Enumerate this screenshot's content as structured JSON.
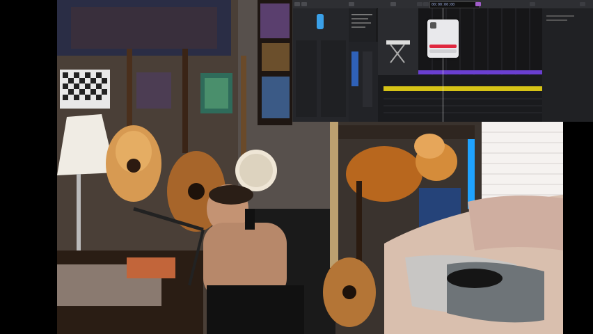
{
  "scene": {
    "description_hidden": "",
    "background": "#000000"
  },
  "daw": {
    "window_title": "",
    "transport": {
      "display": "00:00:00:00"
    },
    "alert": {
      "message": "",
      "ok_label": "",
      "cancel_label": ""
    },
    "colors": {
      "region_purple": "#6a3fd0",
      "region_yellow": "#d6c316",
      "alert_red": "#e0283f",
      "window_bg": "#1b1c1f"
    }
  }
}
